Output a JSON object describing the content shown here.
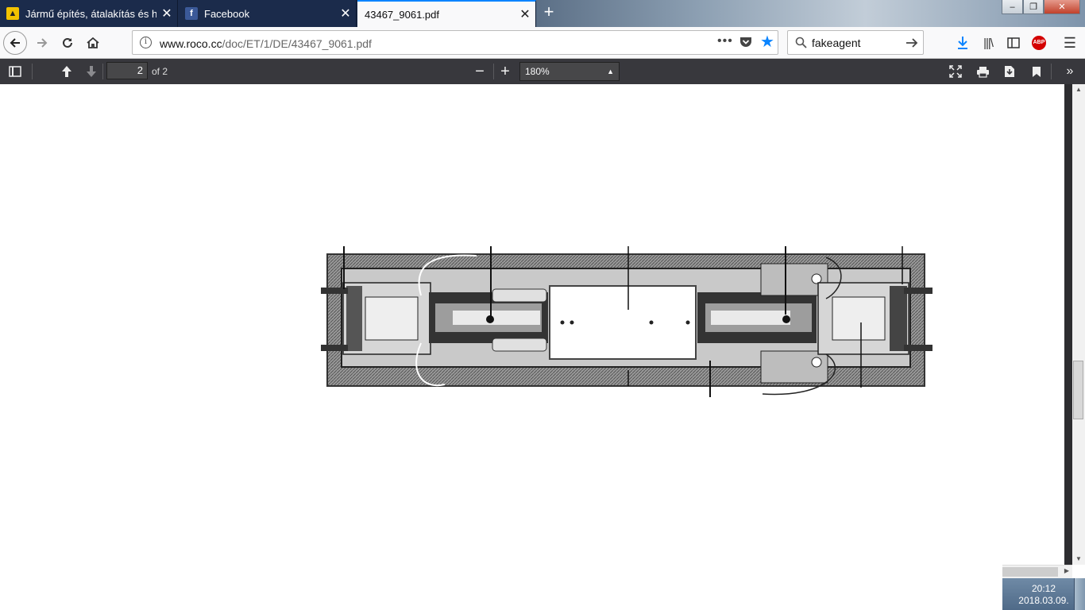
{
  "tabs": [
    {
      "title": "Jármű építés, átalakítás és hasonlók",
      "icon": "forum-icon",
      "close": "✕",
      "active": false
    },
    {
      "title": "Facebook",
      "icon": "facebook-icon",
      "close": "✕",
      "active": false
    },
    {
      "title": "43467_9061.pdf",
      "icon": "",
      "close": "✕",
      "active": true
    }
  ],
  "new_tab_label": "+",
  "window_buttons": {
    "minimize": "–",
    "restore": "❐",
    "close": "✕"
  },
  "navbar": {
    "url_domain": "www.roco.cc",
    "url_path": "/doc/ET/1/DE/43467_9061.pdf",
    "search_value": "fakeagent",
    "search_placeholder": "Search"
  },
  "pdf_toolbar": {
    "current_page": "2",
    "page_of": "of 2",
    "zoom": "180%",
    "zoom_out": "−",
    "zoom_in": "+"
  },
  "taskbar": {
    "time": "20:12",
    "date": "2018.03.09."
  },
  "colors": {
    "tabbar_bg": "#1b2b4b",
    "active_tab_accent": "#0a84ff",
    "pdf_toolbar_bg": "#38383d",
    "abp_red": "#d40000"
  }
}
